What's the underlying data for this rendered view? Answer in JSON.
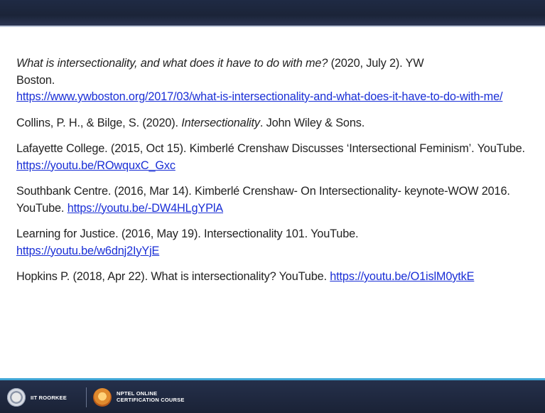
{
  "references": [
    {
      "title": "What is intersectionality, and what does it have to do with me?",
      "rest": " (2020, July 2). YW",
      "line2": "Boston.",
      "url": "https://www.ywboston.org/2017/03/what-is-intersectionality-and-what-does-it-have-to-do-with-me/"
    },
    {
      "prefix": "Collins, P. H., & Bilge, S. (2020). ",
      "italic": "Intersectionality",
      "suffix": ". John Wiley & Sons."
    },
    {
      "text": "Lafayette College. (2015, Oct 15). Kimberlé Crenshaw Discusses ‘Intersectional Feminism’. YouTube. ",
      "url": "https://youtu.be/ROwquxC_Gxc"
    },
    {
      "text": "Southbank Centre. (2016, Mar 14). Kimberlé Crenshaw- On Intersectionality- keynote-WOW 2016. YouTube. ",
      "url": "https://youtu.be/-DW4HLgYPlA"
    },
    {
      "text": "Learning for Justice. (2016, May 19). Intersectionality 101. YouTube.",
      "url": "https://youtu.be/w6dnj2IyYjE"
    },
    {
      "text": "Hopkins P. (2018, Apr 22). What is intersectionality? YouTube. ",
      "url": "https://youtu.be/O1islM0ytkE"
    }
  ],
  "footer": {
    "left_label": "IIT ROORKEE",
    "right_line1": "NPTEL ONLINE",
    "right_line2": "CERTIFICATION COURSE"
  },
  "colors": {
    "top_bar": "#1f2a44",
    "link": "#1a2fd6",
    "accent_rule": "#3fa6d6",
    "footer": "#1f2940"
  }
}
